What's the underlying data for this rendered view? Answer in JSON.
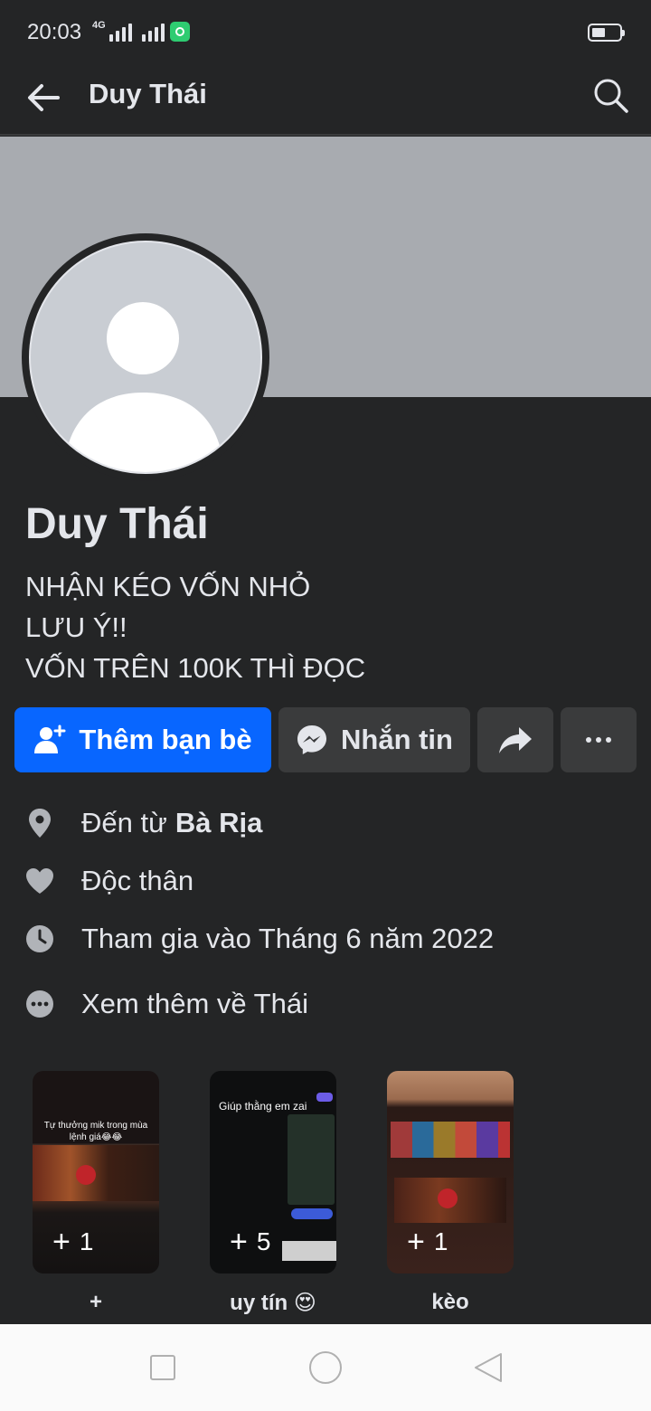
{
  "status_bar": {
    "time": "20:03",
    "network": "4G"
  },
  "header": {
    "title": "Duy Thái"
  },
  "profile": {
    "name": "Duy Thái",
    "bio": [
      "NHẬN KÉO VỐN NHỎ",
      "LƯU Ý!!",
      "VỐN TRÊN 100K THÌ ĐỌC"
    ]
  },
  "actions": {
    "add_friend": "Thêm bạn bè",
    "message": "Nhắn tin"
  },
  "info": {
    "from_prefix": "Đến từ",
    "from_place": "Bà Rịa",
    "relationship": "Độc thân",
    "joined": "Tham gia vào Tháng 6 năm 2022",
    "see_more": "Xem thêm về Thái"
  },
  "highlights": [
    {
      "label": "+",
      "count": "1",
      "caption": "Tự thưởng mik trong mùa lệnh giá😂😂"
    },
    {
      "label": "uy tín 😍",
      "count": "5",
      "caption": "Giúp thằng em zai"
    },
    {
      "label": "kèo",
      "count": "1",
      "caption": ""
    }
  ],
  "colors": {
    "background": "#242526",
    "primary": "#0866ff",
    "secondary_button": "#3a3b3c",
    "cover": "#a8abb0"
  }
}
